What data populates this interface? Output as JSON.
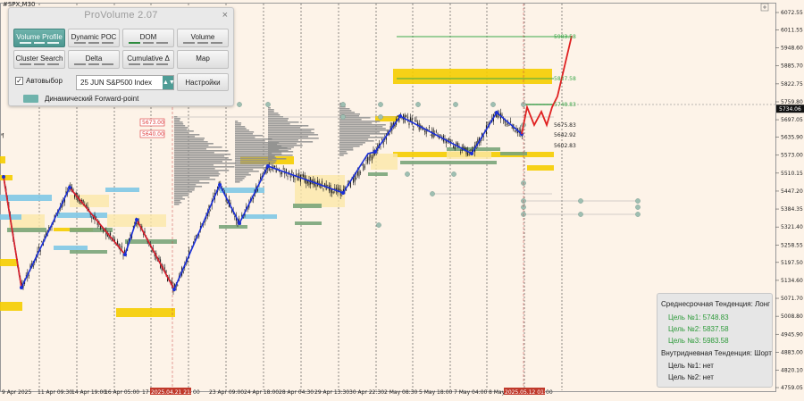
{
  "symbol": "#SPX,M30",
  "panel": {
    "title": "ProVolume 2.07",
    "close": "×",
    "buttons": [
      {
        "id": "volume-profile",
        "label": "Volume Profile",
        "active": true
      },
      {
        "id": "dynamic-poc",
        "label": "Dynamic POC",
        "active": false
      },
      {
        "id": "dom",
        "label": "DOM",
        "active": false
      },
      {
        "id": "volume",
        "label": "Volume",
        "active": false
      },
      {
        "id": "cluster-search",
        "label": "Cluster Search",
        "active": false
      },
      {
        "id": "delta",
        "label": "Delta",
        "active": false
      },
      {
        "id": "cumulative-delta",
        "label": "Cumulative Δ",
        "active": false
      },
      {
        "id": "map",
        "label": "Map",
        "active": false
      }
    ],
    "auto_select": {
      "label": "Автовыбор",
      "checked": "✓"
    },
    "instrument": {
      "value": "25 JUN S&P500 Index",
      "arrow": "▲▼"
    },
    "settings_label": "Настройки",
    "forward_point_label": "Динамический Forward-point"
  },
  "price_axis": [
    "6072.55",
    "6011.55",
    "5948.60",
    "5885.70",
    "5822.75",
    "5759.80",
    "5697.05",
    "5635.90",
    "5573.00",
    "5510.15",
    "5447.20",
    "5384.35",
    "5321.40",
    "5258.55",
    "5197.50",
    "5134.60",
    "5071.70",
    "5008.80",
    "4945.90",
    "4883.00",
    "4820.10",
    "4759.05"
  ],
  "current_price": "5734.06",
  "time_axis": [
    "9 Apr 2025",
    "11 Apr 09:30",
    "14 Apr 19:00",
    "16 Apr 05:00",
    "17 A",
    "2025.04.21 21:00",
    "23 Apr 09:00",
    "24 Apr 18:00",
    "28 Apr 04:30",
    "29 Apr 13:30",
    "30 Apr 22:30",
    "2 May 08:30",
    "5 May 18:00",
    "7 May 04:00",
    "8 May",
    "2025.05.12 01:00"
  ],
  "time_axis_tail": {
    "left": "00",
    "right": "00"
  },
  "level_labels": {
    "target3": "5983.58",
    "target2": "5837.58",
    "target1": "5748.83",
    "l1": "5675.83",
    "l2": "5642.92",
    "l3": "5602.83",
    "red1": "5673.00",
    "red2": "5640.00"
  },
  "colors": {
    "background": "#fdf3e8",
    "bull": "#1a1a1a",
    "zigzag_up": "#1a2fd8",
    "zigzag_down": "#e02020",
    "target": "#3aa84a",
    "volume_profile": "#8c8c8c",
    "yellow_zone": "#f5cd00",
    "blue_zone": "#7fc8e6",
    "panel_accent": "#5aa7a0"
  },
  "trend": {
    "mid_title": "Среднесрочная Тенденция: Лонг",
    "mid_targets": [
      {
        "label": "Цель №1:",
        "value": "5748.83"
      },
      {
        "label": "Цель №2:",
        "value": "5837.58"
      },
      {
        "label": "Цель №3:",
        "value": "5983.58"
      }
    ],
    "intra_title": "Внутридневная Тенденция: Шорт",
    "intra_targets": [
      {
        "label": "Цель №1:",
        "value": "нет"
      },
      {
        "label": "Цель №2:",
        "value": "нет"
      }
    ]
  }
}
